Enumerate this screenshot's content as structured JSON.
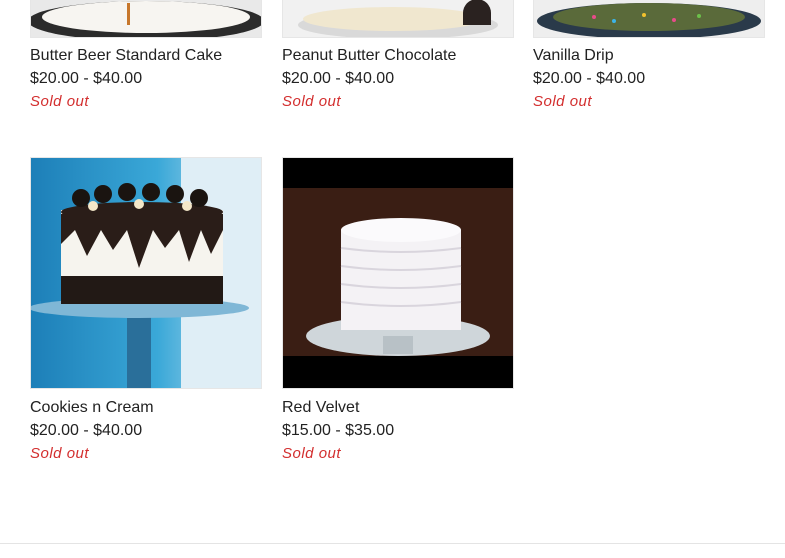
{
  "colors": {
    "sold_out": "#d32f2f",
    "text": "#222222"
  },
  "products": [
    {
      "title": "Butter Beer Standard Cake",
      "price": "$20.00 - $40.00",
      "status": "Sold out",
      "image": "butter-beer-cake-image"
    },
    {
      "title": "Peanut Butter Chocolate",
      "price": "$20.00 - $40.00",
      "status": "Sold out",
      "image": "peanut-butter-chocolate-cake-image"
    },
    {
      "title": "Vanilla Drip",
      "price": "$20.00 - $40.00",
      "status": "Sold out",
      "image": "vanilla-drip-cake-image"
    },
    {
      "title": "Cookies n Cream",
      "price": "$20.00 - $40.00",
      "status": "Sold out",
      "image": "cookies-n-cream-cake-image"
    },
    {
      "title": "Red Velvet",
      "price": "$15.00 - $35.00",
      "status": "Sold out",
      "image": "red-velvet-cake-image"
    }
  ]
}
